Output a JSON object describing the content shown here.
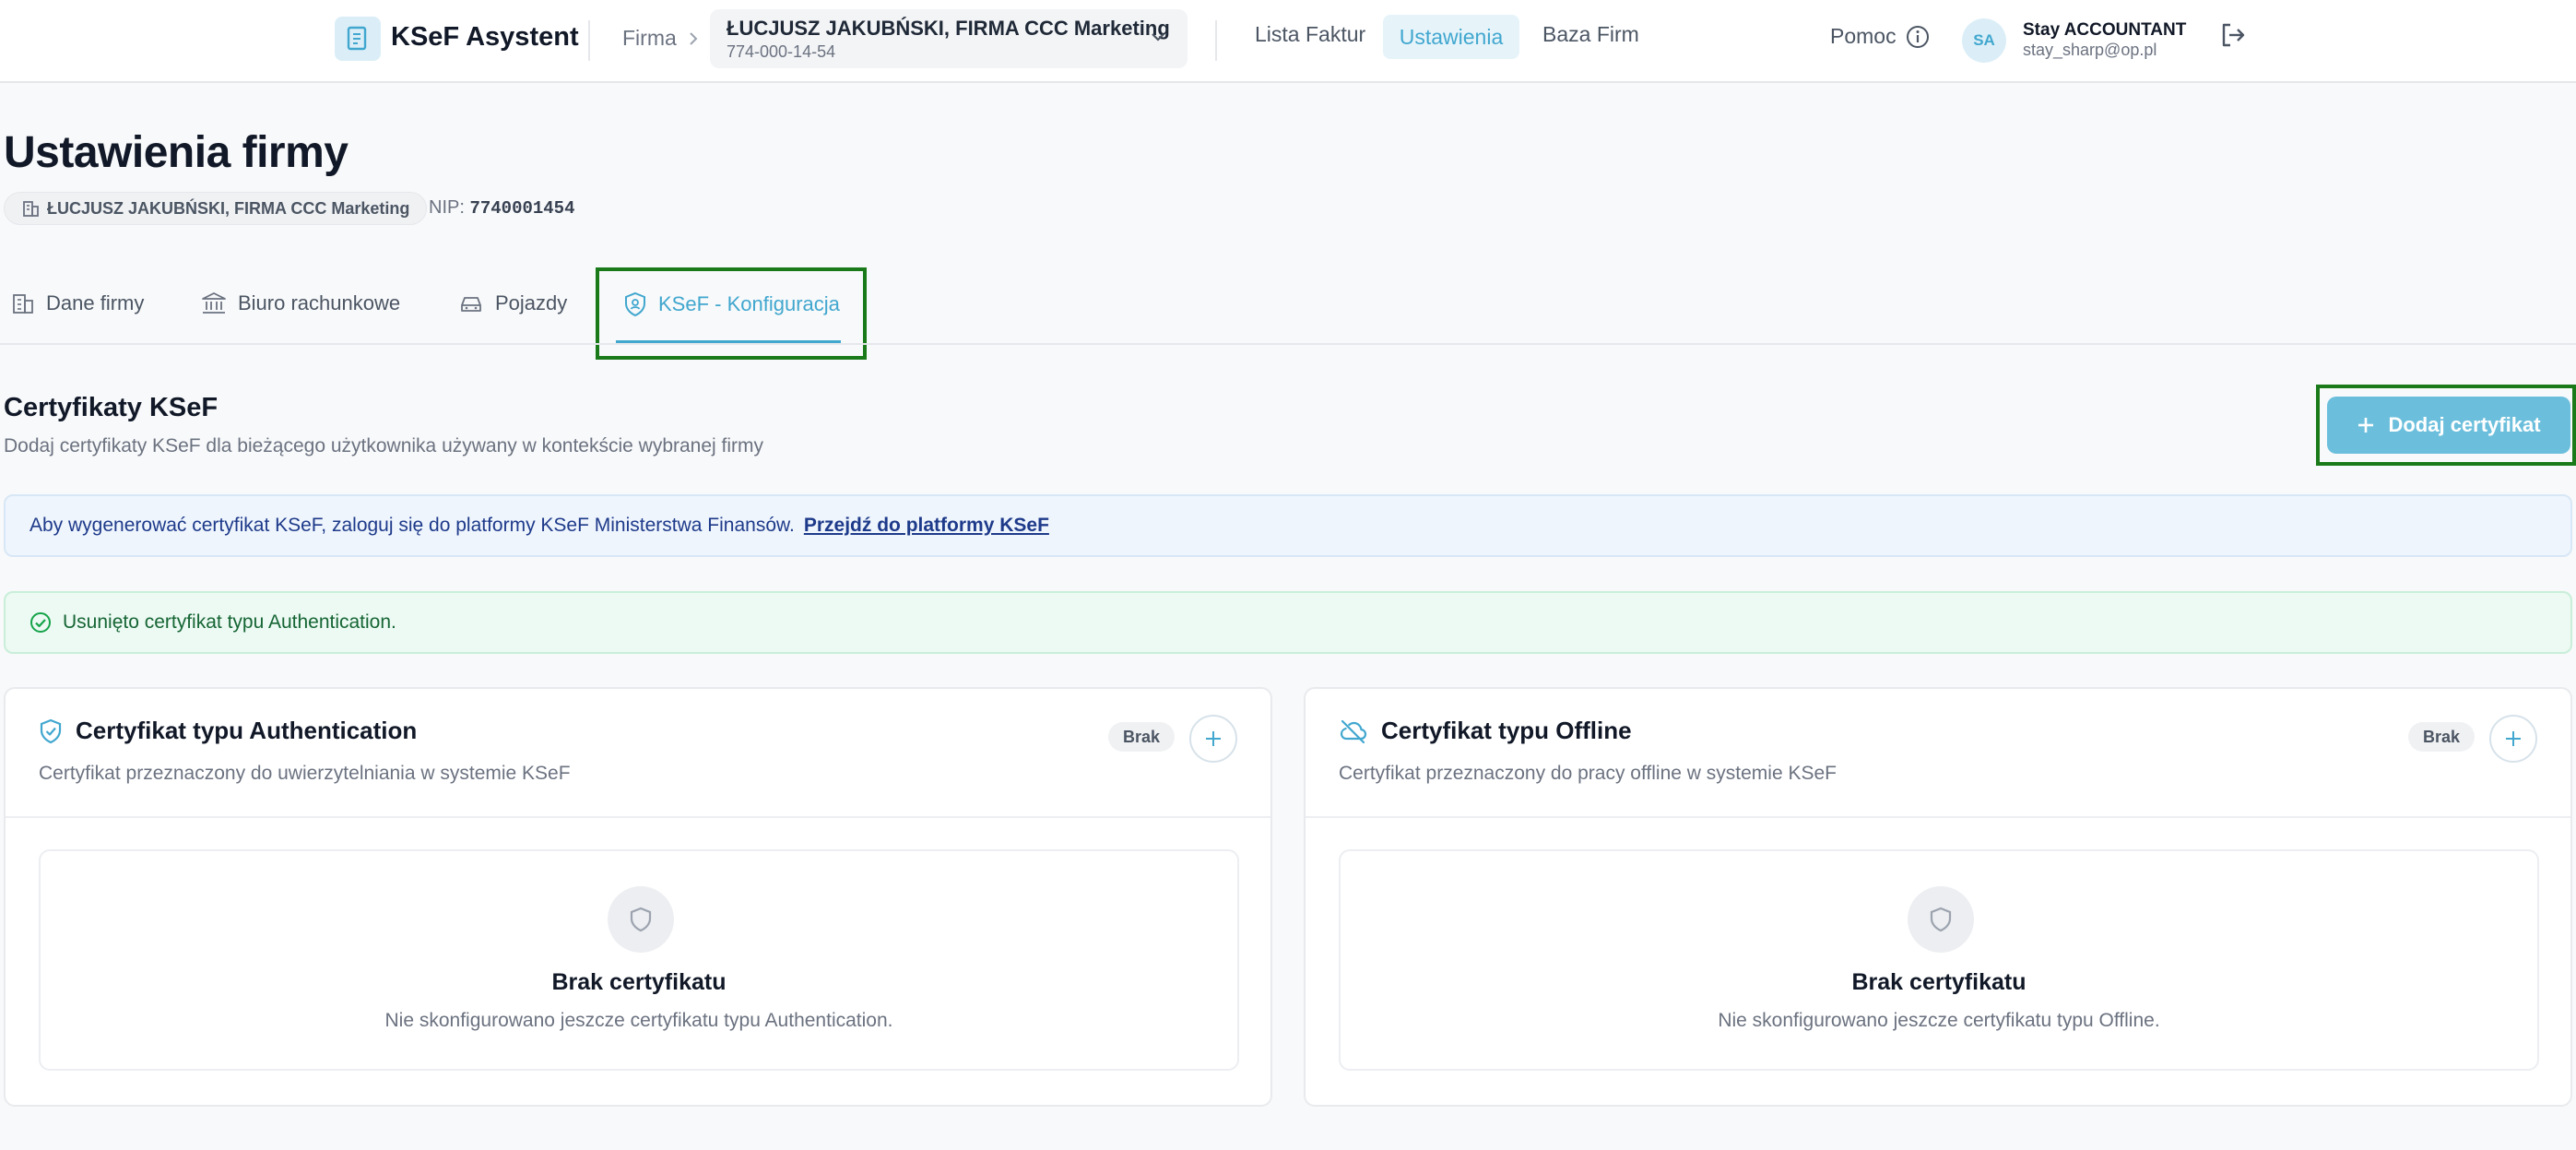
{
  "header": {
    "app_title": "KSeF Asystent",
    "firma_label": "Firma",
    "company": {
      "name": "ŁUCJUSZ JAKUBŃSKI, FIRMA CCC Marketing",
      "nip": "774-000-14-54"
    },
    "nav": [
      {
        "label": "Lista Faktur",
        "active": false
      },
      {
        "label": "Ustawienia",
        "active": true
      },
      {
        "label": "Baza Firm",
        "active": false
      }
    ],
    "help_label": "Pomoc",
    "user": {
      "initials": "SA",
      "name": "Stay ACCOUNTANT",
      "email": "stay_sharp@op.pl"
    }
  },
  "page": {
    "title": "Ustawienia firmy",
    "company_chip": "ŁUCJUSZ JAKUBŃSKI, FIRMA CCC Marketing",
    "nip_label": "NIP:",
    "nip_value": "7740001454"
  },
  "tabs": [
    {
      "label": "Dane firmy",
      "icon": "building-icon",
      "active": false
    },
    {
      "label": "Biuro rachunkowe",
      "icon": "bank-icon",
      "active": false
    },
    {
      "label": "Pojazdy",
      "icon": "car-icon",
      "active": false
    },
    {
      "label": "KSeF - Konfiguracja",
      "icon": "shield-icon",
      "active": true
    }
  ],
  "section": {
    "title": "Certyfikaty KSeF",
    "subtitle": "Dodaj certyfikaty KSeF dla bieżącego użytkownika używany w kontekście wybranej firmy",
    "add_button": "Dodaj certyfikat"
  },
  "info_banner": {
    "text": "Aby wygenerować certyfikat KSeF, zaloguj się do platformy KSeF Ministerstwa Finansów.",
    "link": "Przejdź do platformy KSeF"
  },
  "success_banner": {
    "text": "Usunięto certyfikat typu Authentication."
  },
  "cards": [
    {
      "title": "Certyfikat typu Authentication",
      "icon": "shield-check-icon",
      "description": "Certyfikat przeznaczony do uwierzytelniania w systemie KSeF",
      "badge": "Brak",
      "empty_title": "Brak certyfikatu",
      "empty_desc": "Nie skonfigurowano jeszcze certyfikatu typu Authentication."
    },
    {
      "title": "Certyfikat typu Offline",
      "icon": "cloud-off-icon",
      "description": "Certyfikat przeznaczony do pracy offline w systemie KSeF",
      "badge": "Brak",
      "empty_title": "Brak certyfikatu",
      "empty_desc": "Nie skonfigurowano jeszcze certyfikatu typu Offline."
    }
  ],
  "colors": {
    "accent": "#41a7cf",
    "button": "#6cbfdc",
    "highlight": "#1a7a1a"
  }
}
